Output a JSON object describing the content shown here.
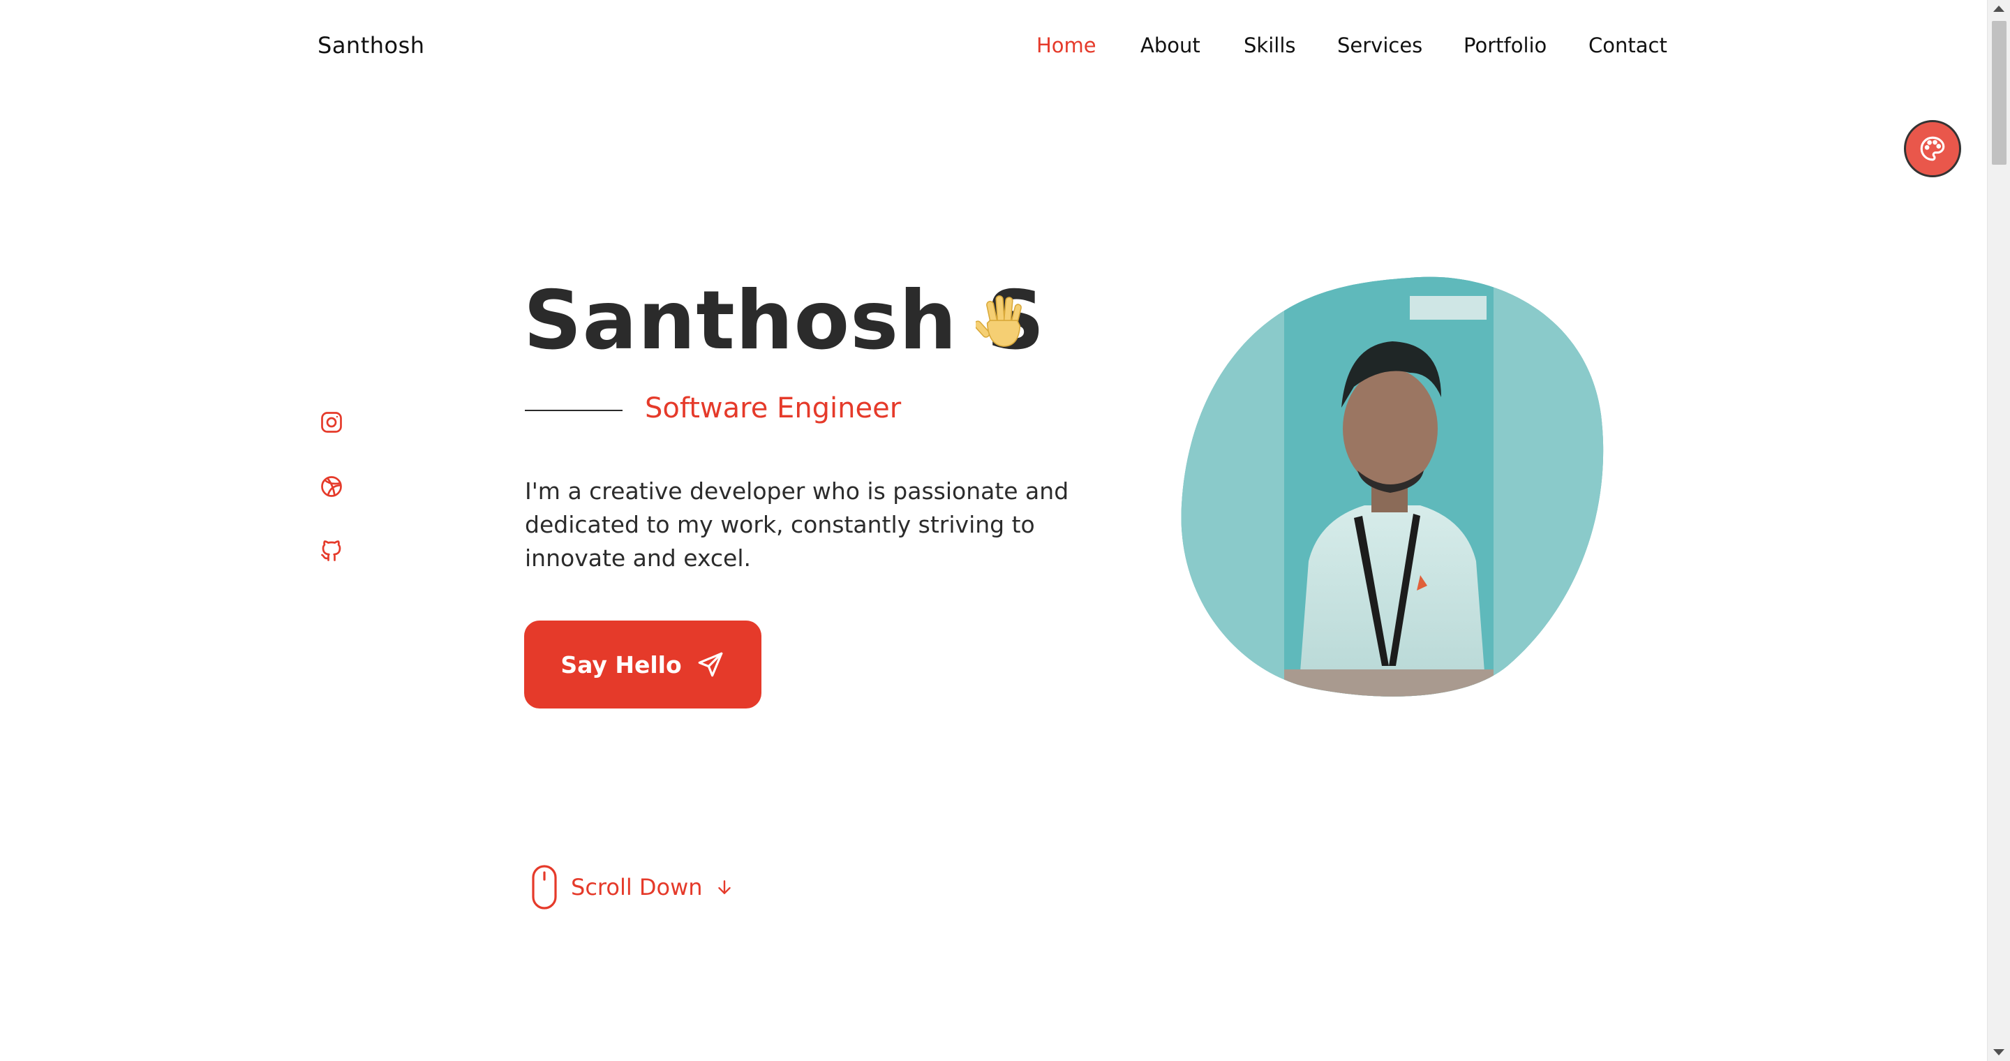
{
  "brand": "Santhosh",
  "nav": {
    "items": [
      {
        "label": "Home",
        "active": true
      },
      {
        "label": "About",
        "active": false
      },
      {
        "label": "Skills",
        "active": false
      },
      {
        "label": "Services",
        "active": false
      },
      {
        "label": "Portfolio",
        "active": false
      },
      {
        "label": "Contact",
        "active": false
      }
    ]
  },
  "theme_button": {
    "icon": "palette-icon"
  },
  "socials": [
    {
      "icon": "instagram-icon"
    },
    {
      "icon": "dribbble-icon"
    },
    {
      "icon": "github-icon"
    }
  ],
  "hero": {
    "name": "Santhosh S",
    "wave_icon": "waving-hand-icon",
    "subtitle": "Software Engineer",
    "description": "I'm a creative developer who is passionate and dedicated to my work, constantly striving to innovate and excel.",
    "cta_label": "Say Hello",
    "cta_icon": "send-icon",
    "scroll_label": "Scroll Down"
  },
  "colors": {
    "accent": "#e53a2a",
    "text": "#2b2b2b",
    "photo_tint": "#7ec4c4"
  }
}
